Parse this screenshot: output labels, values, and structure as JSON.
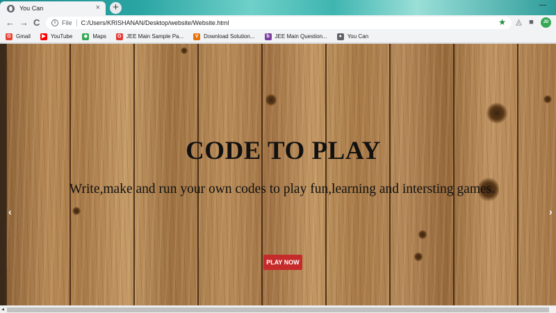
{
  "browser": {
    "tab_title": "You Can",
    "tab_close": "×",
    "new_tab": "+",
    "minimize": "—",
    "back": "←",
    "forward": "→",
    "reload": "C",
    "url_scheme_label": "File",
    "url": "C:/Users/KRISHANAN/Desktop/website/Website.html",
    "avatar_initials": "JD"
  },
  "bookmarks": [
    {
      "label": "Gmail",
      "icon": "gmail-icon",
      "color": "#ea4335",
      "glyph": "G"
    },
    {
      "label": "YouTube",
      "icon": "youtube-icon",
      "color": "#ff0000",
      "glyph": "▶"
    },
    {
      "label": "Maps",
      "icon": "maps-icon",
      "color": "#34a853",
      "glyph": "◆"
    },
    {
      "label": "JEE Main Sample Pa...",
      "icon": "jee-sample-icon",
      "color": "#e53935",
      "glyph": "G"
    },
    {
      "label": "Download Solution...",
      "icon": "download-solution-icon",
      "color": "#e8710a",
      "glyph": "V"
    },
    {
      "label": "JEE Main Question...",
      "icon": "jee-question-icon",
      "color": "#7b3fa0",
      "glyph": "b"
    },
    {
      "label": "You Can",
      "icon": "globe-icon",
      "color": "#5f6368",
      "glyph": "●"
    }
  ],
  "hero": {
    "title": "CODE TO PLAY",
    "subtitle": "Write,make and run your own codes to play fun,learning and intersting games.",
    "button_label": "PLAY NOW",
    "prev_arrow": "‹",
    "next_arrow": "›"
  },
  "colors": {
    "accent_button": "#c62b2b",
    "bookmark_star": "#1e8e3e"
  }
}
